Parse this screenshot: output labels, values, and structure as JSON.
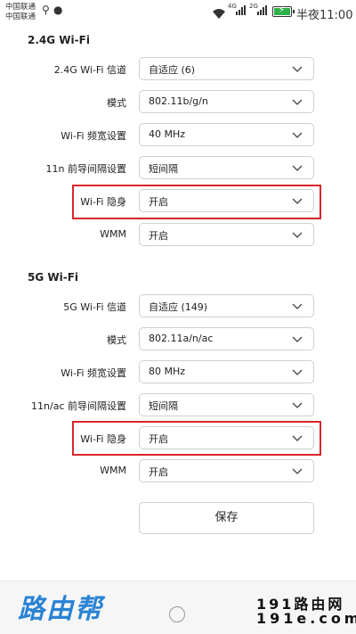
{
  "status_bar": {
    "carrier_1": "中国联通",
    "carrier_2": "中国联通",
    "signal_4g": "4G",
    "signal_2g": "2G",
    "battery_percent": 100,
    "time": "半夜11:00"
  },
  "section_24g": {
    "title": "2.4G Wi-Fi",
    "rows": [
      {
        "label": "2.4G Wi-Fi 信道",
        "value": "自适应 (6)"
      },
      {
        "label": "模式",
        "value": "802.11b/g/n"
      },
      {
        "label": "Wi-Fi 频宽设置",
        "value": "40 MHz"
      },
      {
        "label": "11n 前导间隔设置",
        "value": "短间隔"
      },
      {
        "label": "Wi-Fi 隐身",
        "value": "开启"
      },
      {
        "label": "WMM",
        "value": "开启"
      }
    ]
  },
  "section_5g": {
    "title": "5G Wi-Fi",
    "rows": [
      {
        "label": "5G Wi-Fi 信道",
        "value": "自适应 (149)"
      },
      {
        "label": "模式",
        "value": "802.11a/n/ac"
      },
      {
        "label": "Wi-Fi 频宽设置",
        "value": "80 MHz"
      },
      {
        "label": "11n/ac 前导间隔设置",
        "value": "短间隔"
      },
      {
        "label": "Wi-Fi 隐身",
        "value": "开启"
      },
      {
        "label": "WMM",
        "value": "开启"
      }
    ]
  },
  "save_label": "保存",
  "watermark": {
    "left": "路由帮",
    "right_line1": "191路由网",
    "right_line2": "191e.com"
  },
  "colors": {
    "highlight": "#d9262b",
    "battery": "#2fb24c",
    "watermark_blue": "#2a83d4"
  }
}
